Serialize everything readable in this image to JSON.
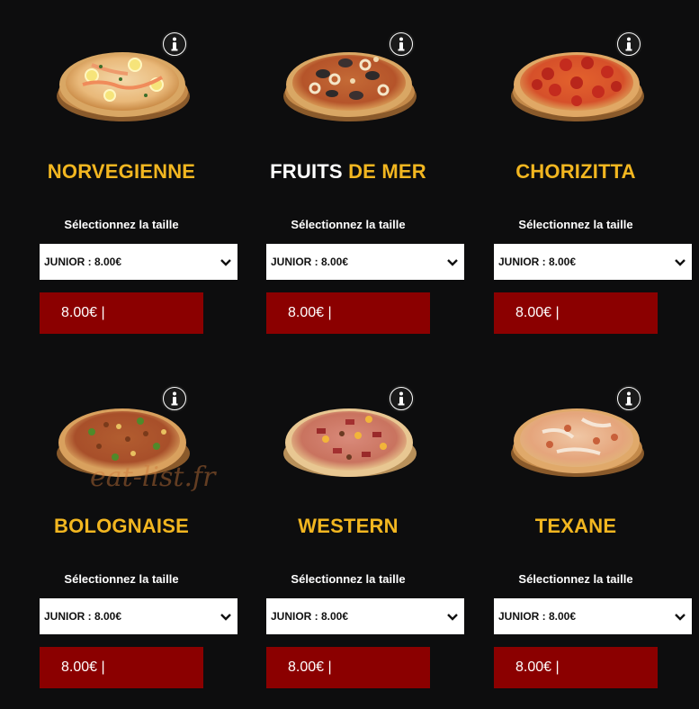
{
  "size_label": "Sélectionnez la taille",
  "watermark": "eat-list.fr",
  "colors": {
    "background": "#0d0d0e",
    "name_accent": "#f2b620",
    "price_bg": "#8b0000"
  },
  "icons": {
    "info": "info-icon",
    "dropdown": "chevron-down-icon"
  },
  "pizzas": [
    {
      "name_a": "NORVEGIENNE",
      "name_b": "",
      "size_value": "JUNIOR : 8.00€",
      "price": "8.00€ |"
    },
    {
      "name_a": "FRUITS",
      "name_b": "DE MER",
      "size_value": "JUNIOR : 8.00€",
      "price": "8.00€ |"
    },
    {
      "name_a": "CHORIZITTA",
      "name_b": "",
      "size_value": "JUNIOR : 8.00€",
      "price": "8.00€ |"
    },
    {
      "name_a": "BOLOGNAISE",
      "name_b": "",
      "size_value": "JUNIOR : 8.00€",
      "price": "8.00€ |"
    },
    {
      "name_a": "WESTERN",
      "name_b": "",
      "size_value": "JUNIOR : 8.00€",
      "price": "8.00€ |"
    },
    {
      "name_a": "TEXANE",
      "name_b": "",
      "size_value": "JUNIOR : 8.00€",
      "price": "8.00€ |"
    }
  ]
}
